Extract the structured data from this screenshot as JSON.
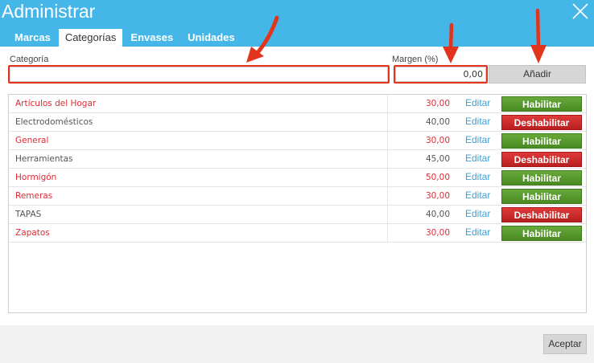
{
  "window": {
    "title": "Administrar"
  },
  "tabs": [
    {
      "label": "Marcas",
      "active": false
    },
    {
      "label": "Categorías",
      "active": true
    },
    {
      "label": "Envases",
      "active": false
    },
    {
      "label": "Unidades",
      "active": false
    }
  ],
  "form": {
    "category_label": "Categoría",
    "category_value": "",
    "margin_label": "Margen (%)",
    "margin_value": "0,00",
    "add_label": "Añadir"
  },
  "table": {
    "edit_label": "Editar",
    "rows": [
      {
        "name": "Artículos del Hogar",
        "margin": "30,00",
        "action": "Habilitar",
        "enabled": false
      },
      {
        "name": "Electrodomésticos",
        "margin": "40,00",
        "action": "Deshabilitar",
        "enabled": true
      },
      {
        "name": "General",
        "margin": "30,00",
        "action": "Habilitar",
        "enabled": false
      },
      {
        "name": "Herramientas",
        "margin": "45,00",
        "action": "Deshabilitar",
        "enabled": true
      },
      {
        "name": "Hormigón",
        "margin": "50,00",
        "action": "Habilitar",
        "enabled": false
      },
      {
        "name": "Remeras",
        "margin": "30,00",
        "action": "Habilitar",
        "enabled": false
      },
      {
        "name": "TAPAS",
        "margin": "40,00",
        "action": "Deshabilitar",
        "enabled": true
      },
      {
        "name": "Zapatos",
        "margin": "30,00",
        "action": "Habilitar",
        "enabled": false
      }
    ]
  },
  "footer": {
    "accept_label": "Aceptar"
  },
  "colors": {
    "header_bg": "#45b6e8",
    "disabled_text": "#e02b35",
    "enabled_text": "#555555",
    "enable_button": "#4a8a22",
    "disable_button": "#b91f1f",
    "edit_link": "#3aa0d6",
    "annotation": "#e2341d"
  },
  "icons": {
    "close": "close-icon",
    "annotation_arrow": "arrow-down-icon"
  }
}
